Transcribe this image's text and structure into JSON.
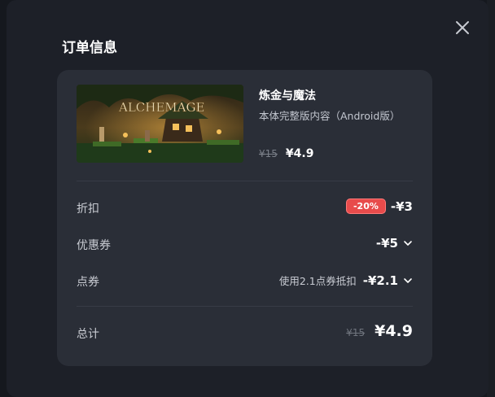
{
  "dialog": {
    "title": "订单信息",
    "close_icon": "close-icon"
  },
  "product": {
    "image_title": "ALCHEMAGE",
    "name": "炼金与魔法",
    "description": "本体完整版内容（Android版）",
    "original_price": "¥15",
    "price": "¥4.9"
  },
  "rows": {
    "discount": {
      "label": "折扣",
      "badge": "-20%",
      "amount": "-¥3"
    },
    "coupon": {
      "label": "优惠券",
      "amount": "-¥5",
      "icon": "chevron-down-icon"
    },
    "points": {
      "label": "点券",
      "hint": "使用2.1点券抵扣",
      "amount": "-¥2.1",
      "icon": "chevron-down-icon"
    },
    "total": {
      "label": "总计",
      "original": "¥15",
      "amount": "¥4.9"
    }
  },
  "colors": {
    "badge": "#e84b4b",
    "card": "#2a2e37",
    "modal": "#1d2028"
  }
}
